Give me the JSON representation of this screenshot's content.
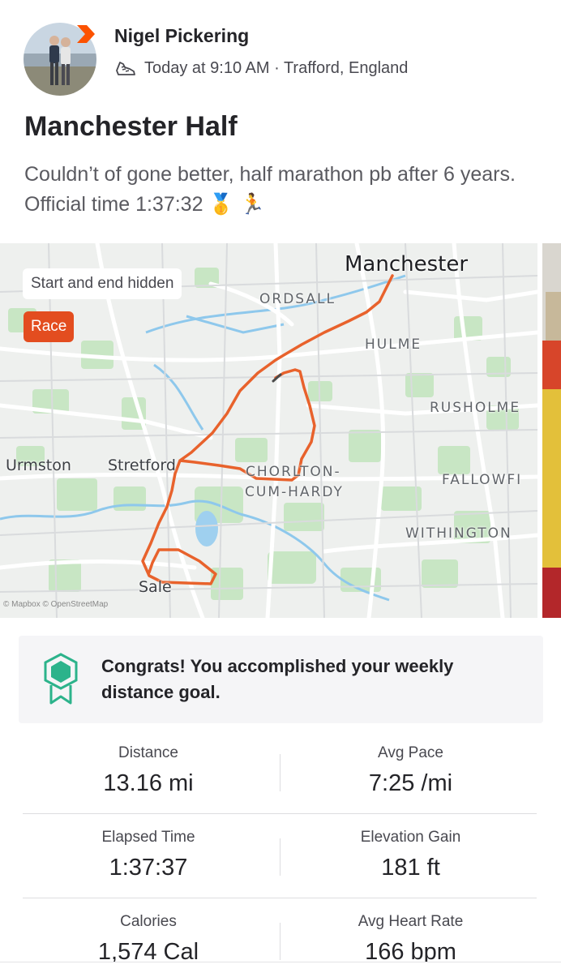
{
  "athlete": {
    "name": "Nigel Pickering",
    "meta": "Today at 9:10 AM · Trafford, England"
  },
  "activity": {
    "title": "Manchester Half",
    "description": "Couldn’t of gone better, half marathon pb after 6 years. Official time 1:37:32 🥇 🏃"
  },
  "map": {
    "privacy_label": "Start and end hidden",
    "workout_tag": "Race",
    "route_color": "#e8622c",
    "labels": {
      "manchester": "Manchester",
      "ordsall": "ORDSALL",
      "hulme": "HULME",
      "rusholme": "RUSHOLME",
      "urmston": "Urmston",
      "stretford": "Stretford",
      "chorlton_1": "CHORLTON-",
      "chorlton_2": "CUM-HARDY",
      "fallowfield": "FALLOWFI",
      "withington": "WITHINGTON",
      "sale": "Sale"
    },
    "attribution": "© Mapbox © OpenStreetMap"
  },
  "goal": {
    "text": "Congrats! You accomplished your weekly distance goal."
  },
  "stats": [
    {
      "label": "Distance",
      "value": "13.16 mi"
    },
    {
      "label": "Avg Pace",
      "value": "7:25 /mi"
    },
    {
      "label": "Elapsed Time",
      "value": "1:37:37"
    },
    {
      "label": "Elevation Gain",
      "value": "181 ft"
    },
    {
      "label": "Calories",
      "value": "1,574 Cal"
    },
    {
      "label": "Avg Heart Rate",
      "value": "166 bpm"
    }
  ],
  "colors": {
    "accent": "#fc5200",
    "race_tag": "#e34d1f",
    "goal_badge": "#2cb38b"
  }
}
